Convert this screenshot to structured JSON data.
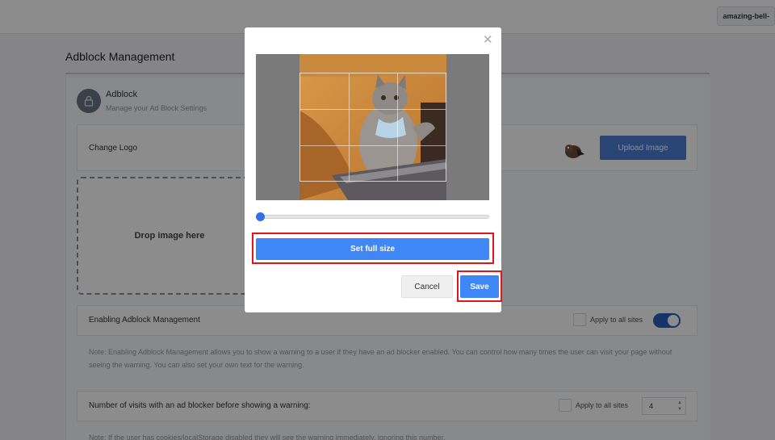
{
  "header": {
    "user_chip": "amazing-bell-"
  },
  "page": {
    "title": "Adblock Management",
    "section_title": "Adblock",
    "section_subtitle": "Manage your Ad Block Settings"
  },
  "logo_row": {
    "label": "Change Logo",
    "upload_button": "Upload Image"
  },
  "dropzone": {
    "text": "Drop image here"
  },
  "enable_row": {
    "label": "Enabling Adblock Management",
    "apply_all": "Apply to all sites",
    "toggle_on": true
  },
  "note1": "Note: Enabling Adblock Management allows you to show a warning to a user if they have an ad blocker enabled. You can control how many times the user can visit your page without seeing the warning. You can also set your own text for the warning.",
  "visits_row": {
    "label": "Number of visits with an ad blocker before showing a warning:",
    "apply_all": "Apply to all sites",
    "value": "4"
  },
  "note2": "Note: If the user has cookies/localStorage disabled they will see the warning immediately, ignoring this number.",
  "modal": {
    "close_icon": "close-icon",
    "zoom_level": 0,
    "set_full_size": "Set full size",
    "cancel": "Cancel",
    "save": "Save"
  },
  "colors": {
    "primary": "#3f86f7",
    "highlight": "#e3141b",
    "toggle": "#2a5fbf"
  }
}
